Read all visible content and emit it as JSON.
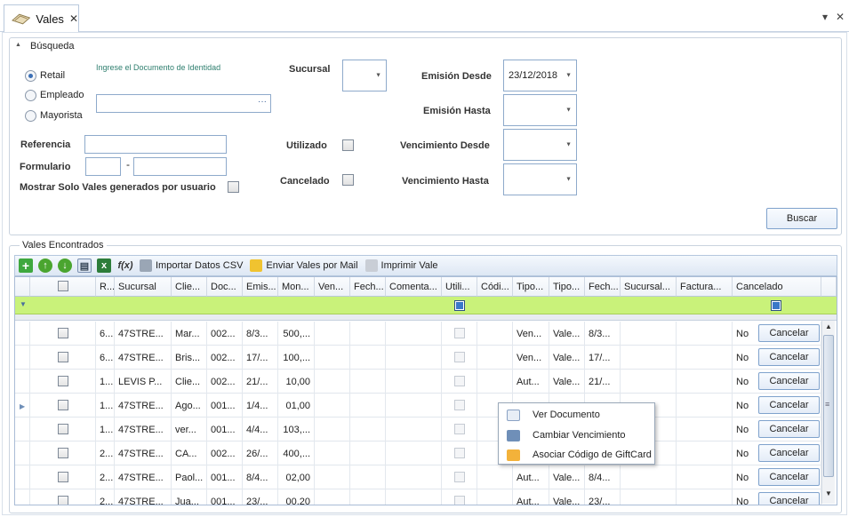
{
  "tab": {
    "title": "Vales",
    "close": "✕"
  },
  "window": {
    "dropdown": "▾",
    "close": "✕"
  },
  "search": {
    "group_title": "Búsqueda",
    "collapse_icon": "▲",
    "radios": [
      {
        "label": "Retail",
        "checked": true
      },
      {
        "label": "Empleado",
        "checked": false
      },
      {
        "label": "Mayorista",
        "checked": false
      }
    ],
    "doc_hint": "Ingrese el Documento de Identidad",
    "doc_button": "···",
    "referencia_label": "Referencia",
    "formulario_label": "Formulario",
    "formulario_sep": "-",
    "mostrar_label": "Mostrar Solo Vales generados por usuario",
    "sucursal_label": "Sucursal",
    "utilizado_label": "Utilizado",
    "cancelado_label": "Cancelado",
    "emision_desde_label": "Emisión Desde",
    "emision_desde_value": "23/12/2018",
    "emision_hasta_label": "Emisión Hasta",
    "vencimiento_desde_label": "Vencimiento Desde",
    "vencimiento_hasta_label": "Vencimiento Hasta",
    "buscar_label": "Buscar"
  },
  "results": {
    "group_title": "Vales Encontrados",
    "toolbar": {
      "importar": "Importar Datos CSV",
      "enviar": "Enviar Vales por Mail",
      "imprimir": "Imprimir Vale"
    },
    "columns": [
      "R...",
      "Sucursal",
      "Clie...",
      "Doc...",
      "Emis...",
      "Mon...",
      "Ven...",
      "Fech...",
      "Comenta...",
      "Utili...",
      "Códi...",
      "Tipo...",
      "Tipo...",
      "Fech...",
      "Sucursal...",
      "Factura...",
      "Cancelado"
    ],
    "rows": [
      {
        "r": "6...",
        "sucursal": "47STRE...",
        "cliente": "Mar...",
        "doc": "002...",
        "emision": "8/3...",
        "monto": "500,...",
        "tipo1": "Ven...",
        "tipo2": "Vale...",
        "fecha": "8/3...",
        "cancelado": "No"
      },
      {
        "r": "6...",
        "sucursal": "47STRE...",
        "cliente": "Bris...",
        "doc": "002...",
        "emision": "17/...",
        "monto": "100,...",
        "tipo1": "Ven...",
        "tipo2": "Vale...",
        "fecha": "17/...",
        "cancelado": "No"
      },
      {
        "r": "1...",
        "sucursal": "LEVIS P...",
        "cliente": "Clie...",
        "doc": "002...",
        "emision": "21/...",
        "monto": "10,00",
        "tipo1": "Aut...",
        "tipo2": "Vale...",
        "fecha": "21/...",
        "cancelado": "No"
      },
      {
        "r": "1...",
        "sucursal": "47STRE...",
        "cliente": "Ago...",
        "doc": "001...",
        "emision": "1/4...",
        "monto": "01,00",
        "tipo1": "",
        "tipo2": "",
        "fecha": "",
        "cancelado": "No"
      },
      {
        "r": "1...",
        "sucursal": "47STRE...",
        "cliente": "ver...",
        "doc": "001...",
        "emision": "4/4...",
        "monto": "103,...",
        "tipo1": "",
        "tipo2": "",
        "fecha": "",
        "cancelado": "No"
      },
      {
        "r": "2...",
        "sucursal": "47STRE...",
        "cliente": "CA...",
        "doc": "002...",
        "emision": "26/...",
        "monto": "400,...",
        "tipo1": "",
        "tipo2": "",
        "fecha": "",
        "cancelado": "No"
      },
      {
        "r": "2...",
        "sucursal": "47STRE...",
        "cliente": "Paol...",
        "doc": "001...",
        "emision": "8/4...",
        "monto": "02,00",
        "tipo1": "Aut...",
        "tipo2": "Vale...",
        "fecha": "8/4...",
        "cancelado": "No"
      },
      {
        "r": "2...",
        "sucursal": "47STRE...",
        "cliente": "Jua...",
        "doc": "001...",
        "emision": "23/...",
        "monto": "00,20",
        "tipo1": "Aut...",
        "tipo2": "Vale...",
        "fecha": "23/...",
        "cancelado": "No"
      }
    ],
    "cancel_button": "Cancelar"
  },
  "context_menu": [
    {
      "label": "Ver Documento",
      "icon": "document-icon"
    },
    {
      "label": "Cambiar Vencimiento",
      "icon": "swap-icon"
    },
    {
      "label": "Asociar Código de GiftCard",
      "icon": "giftcard-icon"
    }
  ],
  "colors": {
    "accent": "#3b6fb6",
    "filter_row": "#c9f27a"
  }
}
